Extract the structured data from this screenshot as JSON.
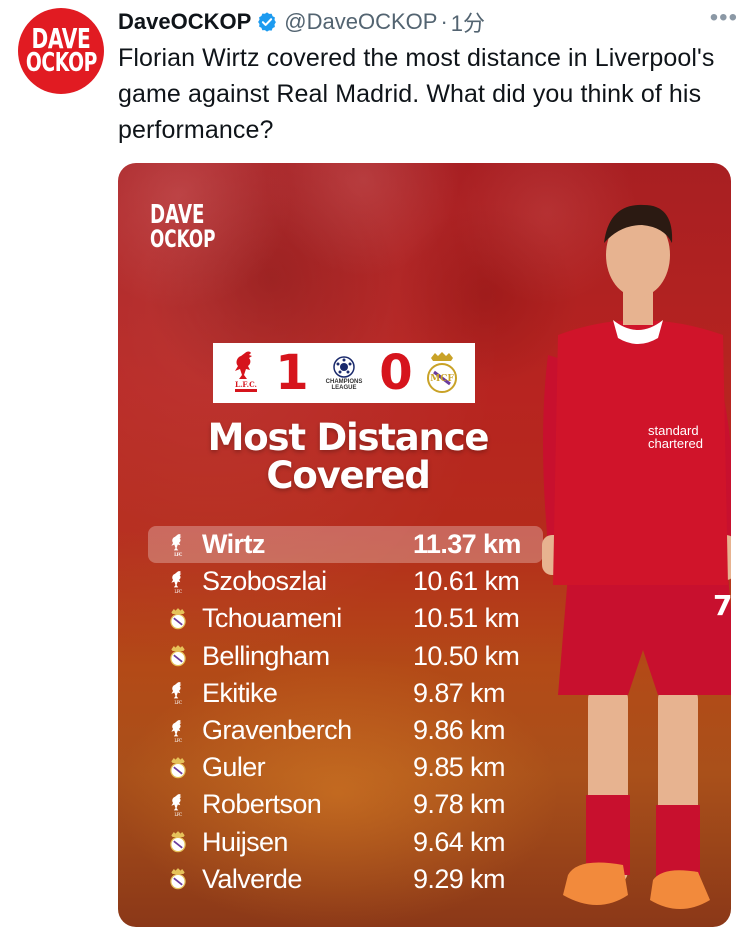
{
  "tweet": {
    "display_name": "DaveOCKOP",
    "handle": "@DaveOCKOP",
    "separator": "·",
    "time": "1分",
    "more": "•••",
    "text": "Florian Wirtz covered the most distance in Liverpool's game against Real Madrid. What did you think of his performance?"
  },
  "avatar": {
    "line1": "DAVE",
    "line2": "OCKOP"
  },
  "media": {
    "logo": {
      "line1": "DAVE",
      "line2": "OCKOP"
    },
    "score": {
      "home": "1",
      "away": "0",
      "competition_line1": "CHAMPIONS",
      "competition_line2": "LEAGUE"
    },
    "title_line1": "Most Distance",
    "title_line2": "Covered",
    "rows": [
      {
        "name": "Wirtz",
        "distance": "11.37 km",
        "team": "liverpool",
        "highlight": true
      },
      {
        "name": "Szoboszlai",
        "distance": "10.61 km",
        "team": "liverpool"
      },
      {
        "name": "Tchouameni",
        "distance": "10.51 km",
        "team": "real-madrid"
      },
      {
        "name": "Bellingham",
        "distance": "10.50 km",
        "team": "real-madrid"
      },
      {
        "name": "Ekitike",
        "distance": "9.87 km",
        "team": "liverpool"
      },
      {
        "name": "Gravenberch",
        "distance": "9.86 km",
        "team": "liverpool"
      },
      {
        "name": "Guler",
        "distance": "9.85 km",
        "team": "real-madrid"
      },
      {
        "name": "Robertson",
        "distance": "9.78 km",
        "team": "liverpool"
      },
      {
        "name": "Huijsen",
        "distance": "9.64 km",
        "team": "real-madrid"
      },
      {
        "name": "Valverde",
        "distance": "9.29 km",
        "team": "real-madrid"
      }
    ],
    "shirt": {
      "sponsor_line1": "standard",
      "sponsor_line2": "chartered",
      "number": "7"
    }
  },
  "colors": {
    "brand_red": "#e11b22",
    "verified_blue": "#1d9bf0",
    "score_red": "#d6141c",
    "text_grey": "#536471"
  }
}
